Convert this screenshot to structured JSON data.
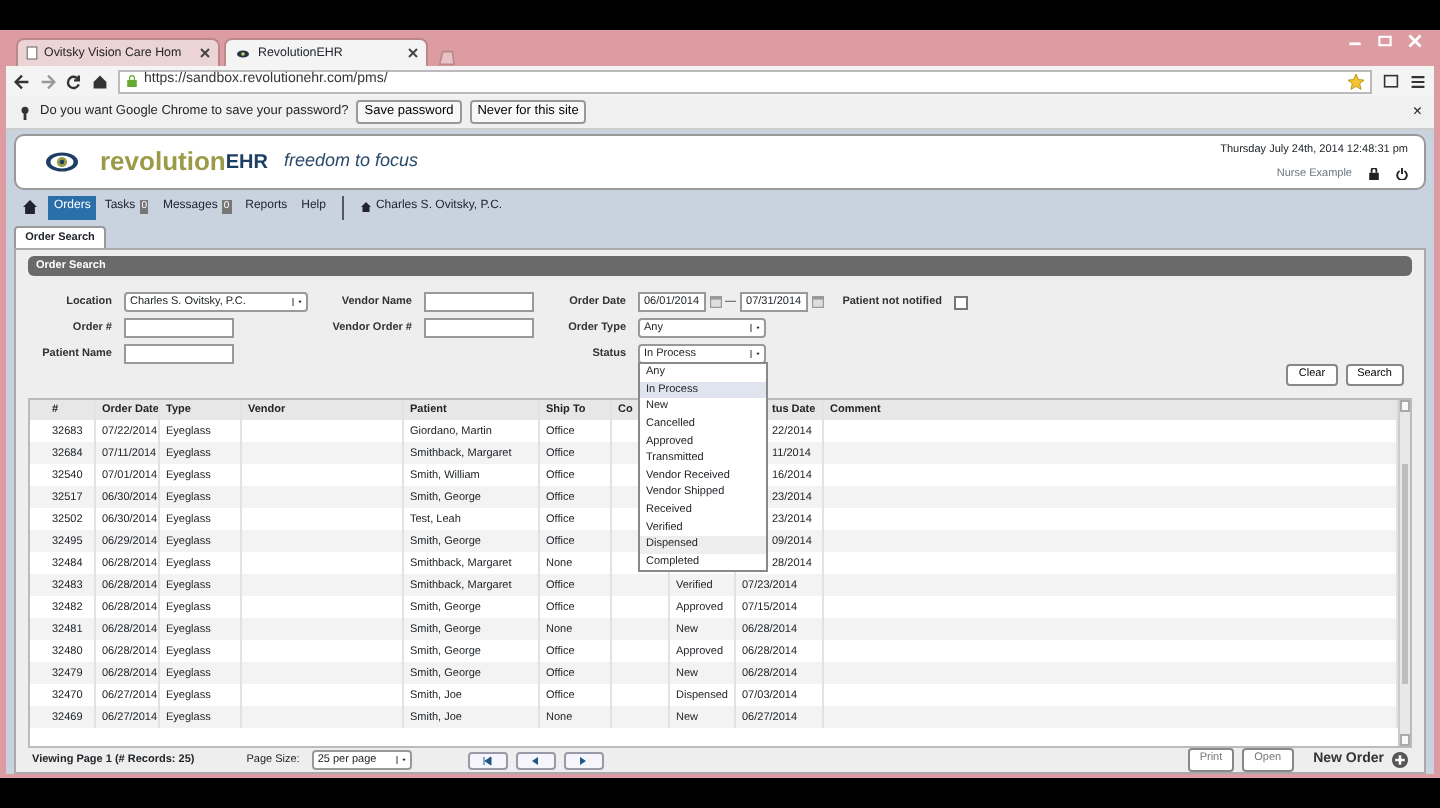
{
  "browser": {
    "tabs": [
      {
        "title": "Ovitsky Vision Care Hom",
        "selected": false
      },
      {
        "title": "RevolutionEHR",
        "selected": true
      }
    ],
    "url": "https://sandbox.revolutionehr.com/pms/",
    "password_bar": {
      "question": "Do you want Google Chrome to save your password?",
      "buttons": [
        "Save password",
        "Never for this site"
      ],
      "close": "×"
    }
  },
  "app_header": {
    "logo_main": "revolution",
    "logo_suffix": "EHR",
    "tagline": "freedom to focus",
    "datetime": "Thursday July 24th, 2014 12:48:31 pm",
    "user": "Nurse Example"
  },
  "nav": {
    "items": [
      {
        "label": "Orders",
        "selected": true
      },
      {
        "label": "Tasks",
        "count": "0",
        "selected": false
      },
      {
        "label": "Messages",
        "count": "0",
        "selected": false
      },
      {
        "label": "Reports",
        "selected": false
      },
      {
        "label": "Help",
        "selected": false
      }
    ],
    "practice": "Charles S. Ovitsky, P.C."
  },
  "page_tab": "Order Search",
  "panel_title": "Order Search",
  "form": {
    "location": {
      "label": "Location",
      "value": "Charles S. Ovitsky, P.C."
    },
    "vendor_name": {
      "label": "Vendor Name"
    },
    "order_date": {
      "label": "Order Date",
      "from": "06/01/2014",
      "separator": "—",
      "to": "07/31/2014"
    },
    "patient_not_notified": {
      "label": "Patient not notified",
      "checked": false
    },
    "order_number": {
      "label": "Order #"
    },
    "vendor_order_number": {
      "label": "Vendor Order #"
    },
    "order_type": {
      "label": "Order Type",
      "value": "Any"
    },
    "patient_name": {
      "label": "Patient Name"
    },
    "status": {
      "label": "Status",
      "value": "In Process",
      "options": [
        {
          "label": "Any",
          "selected": false,
          "hovered": false
        },
        {
          "label": "In Process",
          "selected": true,
          "hovered": false
        },
        {
          "label": "New",
          "selected": false,
          "hovered": false
        },
        {
          "label": "Cancelled",
          "selected": false,
          "hovered": false
        },
        {
          "label": "Approved",
          "selected": false,
          "hovered": false
        },
        {
          "label": "Transmitted",
          "selected": false,
          "hovered": false
        },
        {
          "label": "Vendor Received",
          "selected": false,
          "hovered": false
        },
        {
          "label": "Vendor Shipped",
          "selected": false,
          "hovered": false
        },
        {
          "label": "Received",
          "selected": false,
          "hovered": false
        },
        {
          "label": "Verified",
          "selected": false,
          "hovered": false
        },
        {
          "label": "Dispensed",
          "selected": false,
          "hovered": true
        },
        {
          "label": "Completed",
          "selected": false,
          "hovered": false
        }
      ]
    },
    "buttons": [
      "Clear",
      "Search"
    ]
  },
  "table": {
    "columns": [
      "#",
      "Order Date",
      "Type",
      "Vendor",
      "Patient",
      "Ship To",
      "Co",
      "",
      "tus Date",
      "Comment"
    ],
    "rows": [
      [
        "32683",
        "07/22/2014",
        "Eyeglass",
        "",
        "Giordano, Martin",
        "Office",
        "",
        "",
        "22/2014",
        ""
      ],
      [
        "32684",
        "07/11/2014",
        "Eyeglass",
        "",
        "Smithback, Margaret",
        "Office",
        "",
        "",
        "11/2014",
        ""
      ],
      [
        "32540",
        "07/01/2014",
        "Eyeglass",
        "",
        "Smith, William",
        "Office",
        "",
        "",
        "16/2014",
        ""
      ],
      [
        "32517",
        "06/30/2014",
        "Eyeglass",
        "",
        "Smith, George",
        "Office",
        "",
        "",
        "23/2014",
        ""
      ],
      [
        "32502",
        "06/30/2014",
        "Eyeglass",
        "",
        "Test, Leah",
        "Office",
        "",
        "",
        "23/2014",
        ""
      ],
      [
        "32495",
        "06/29/2014",
        "Eyeglass",
        "",
        "Smith, George",
        "Office",
        "",
        "",
        "09/2014",
        ""
      ],
      [
        "32484",
        "06/28/2014",
        "Eyeglass",
        "",
        "Smithback, Margaret",
        "None",
        "",
        "",
        "28/2014",
        ""
      ],
      [
        "32483",
        "06/28/2014",
        "Eyeglass",
        "",
        "Smithback, Margaret",
        "Office",
        "",
        "Verified",
        "07/23/2014",
        ""
      ],
      [
        "32482",
        "06/28/2014",
        "Eyeglass",
        "",
        "Smith, George",
        "Office",
        "",
        "Approved",
        "07/15/2014",
        ""
      ],
      [
        "32481",
        "06/28/2014",
        "Eyeglass",
        "",
        "Smith, George",
        "None",
        "",
        "New",
        "06/28/2014",
        ""
      ],
      [
        "32480",
        "06/28/2014",
        "Eyeglass",
        "",
        "Smith, George",
        "Office",
        "",
        "Approved",
        "06/28/2014",
        ""
      ],
      [
        "32479",
        "06/28/2014",
        "Eyeglass",
        "",
        "Smith, George",
        "Office",
        "",
        "New",
        "06/28/2014",
        ""
      ],
      [
        "32470",
        "06/27/2014",
        "Eyeglass",
        "",
        "Smith, Joe",
        "Office",
        "",
        "Dispensed",
        "07/03/2014",
        ""
      ],
      [
        "32469",
        "06/27/2014",
        "Eyeglass",
        "",
        "Smith, Joe",
        "None",
        "",
        "New",
        "06/27/2014",
        ""
      ]
    ]
  },
  "footer": {
    "viewing": "Viewing Page 1 (# Records: 25)",
    "page_size_label": "Page Size:",
    "page_size": "25 per page",
    "buttons": [
      "Print",
      "Open"
    ],
    "new_order": "New Order"
  }
}
